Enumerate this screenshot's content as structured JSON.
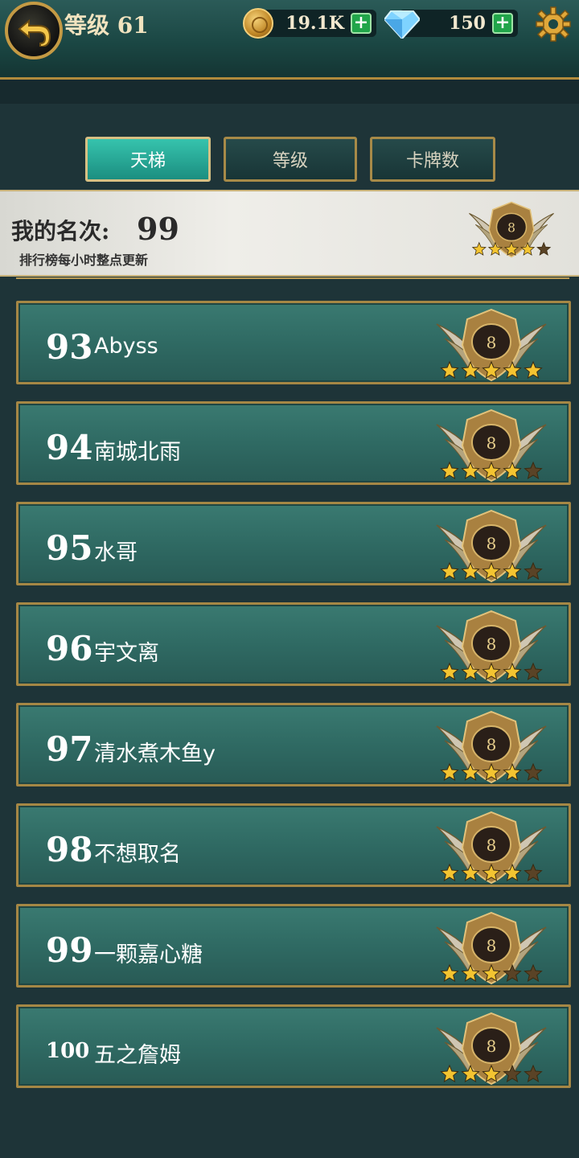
{
  "header": {
    "level_label": "等级 61",
    "gold_amount": "19.1K",
    "gem_amount": "150",
    "plus_symbol": "+"
  },
  "tabs": [
    {
      "label": "天梯",
      "active": true
    },
    {
      "label": "等级",
      "active": false
    },
    {
      "label": "卡牌数",
      "active": false
    }
  ],
  "my_rank": {
    "label": "我的名次:",
    "value": "99",
    "update_note": "排行榜每小时整点更新",
    "badge_level": "8",
    "badge_stars": 4
  },
  "leaderboard": [
    {
      "rank": "93",
      "name": "Abyss",
      "badge_level": "8",
      "stars": 5
    },
    {
      "rank": "94",
      "name": "南城北雨",
      "badge_level": "8",
      "stars": 4
    },
    {
      "rank": "95",
      "name": "水哥",
      "badge_level": "8",
      "stars": 4
    },
    {
      "rank": "96",
      "name": "宇文离",
      "badge_level": "8",
      "stars": 4
    },
    {
      "rank": "97",
      "name": "清水煮木鱼y",
      "badge_level": "8",
      "stars": 4
    },
    {
      "rank": "98",
      "name": "不想取名",
      "badge_level": "8",
      "stars": 4
    },
    {
      "rank": "99",
      "name": "一颗嘉心糖",
      "badge_level": "8",
      "stars": 3
    },
    {
      "rank": "100",
      "name": "五之詹姆",
      "badge_level": "8",
      "stars": 3
    }
  ],
  "colors": {
    "accent_teal": "#2fb6a2",
    "gold_trim": "#b08a3c",
    "star_gold": "#f3c431",
    "star_empty": "#5a4326"
  },
  "icons": [
    "back-arrow-icon",
    "gold-coin-icon",
    "diamond-icon",
    "gear-icon",
    "rank-badge-icon",
    "star-icon"
  ]
}
